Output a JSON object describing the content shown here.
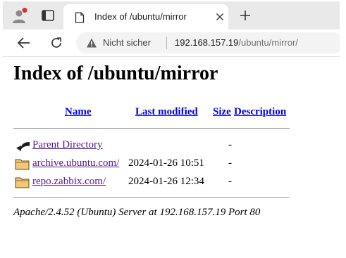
{
  "browser": {
    "tab": {
      "title": "Index of /ubuntu/mirror",
      "close_label": "×"
    },
    "new_tab_label": "+",
    "address_bar": {
      "security_label": "Nicht sicher",
      "url_host": "192.168.157.19",
      "url_path": "/ubuntu/mirror/"
    },
    "colors": {
      "tab_strip": "#e9e9e9",
      "profile_badge": "#d93025",
      "omnibox": "#f3f3f3"
    }
  },
  "page": {
    "title": "Index of /ubuntu/mirror",
    "columns": {
      "name": "Name",
      "last_modified": "Last modified",
      "size": "Size",
      "description": "Description"
    },
    "rows": [
      {
        "icon": "back-arrow-icon",
        "name": "Parent Directory",
        "modified": "",
        "size": "-"
      },
      {
        "icon": "folder-icon",
        "name": "archive.ubuntu.com/",
        "modified": "2024-01-26 10:51",
        "size": "-"
      },
      {
        "icon": "folder-icon",
        "name": "repo.zabbix.com/",
        "modified": "2024-01-26 12:34",
        "size": "-"
      }
    ],
    "address": "Apache/2.4.52 (Ubuntu) Server at 192.168.157.19 Port 80",
    "colors": {
      "link": "#0000ee",
      "visited_link": "#551a8b"
    }
  }
}
